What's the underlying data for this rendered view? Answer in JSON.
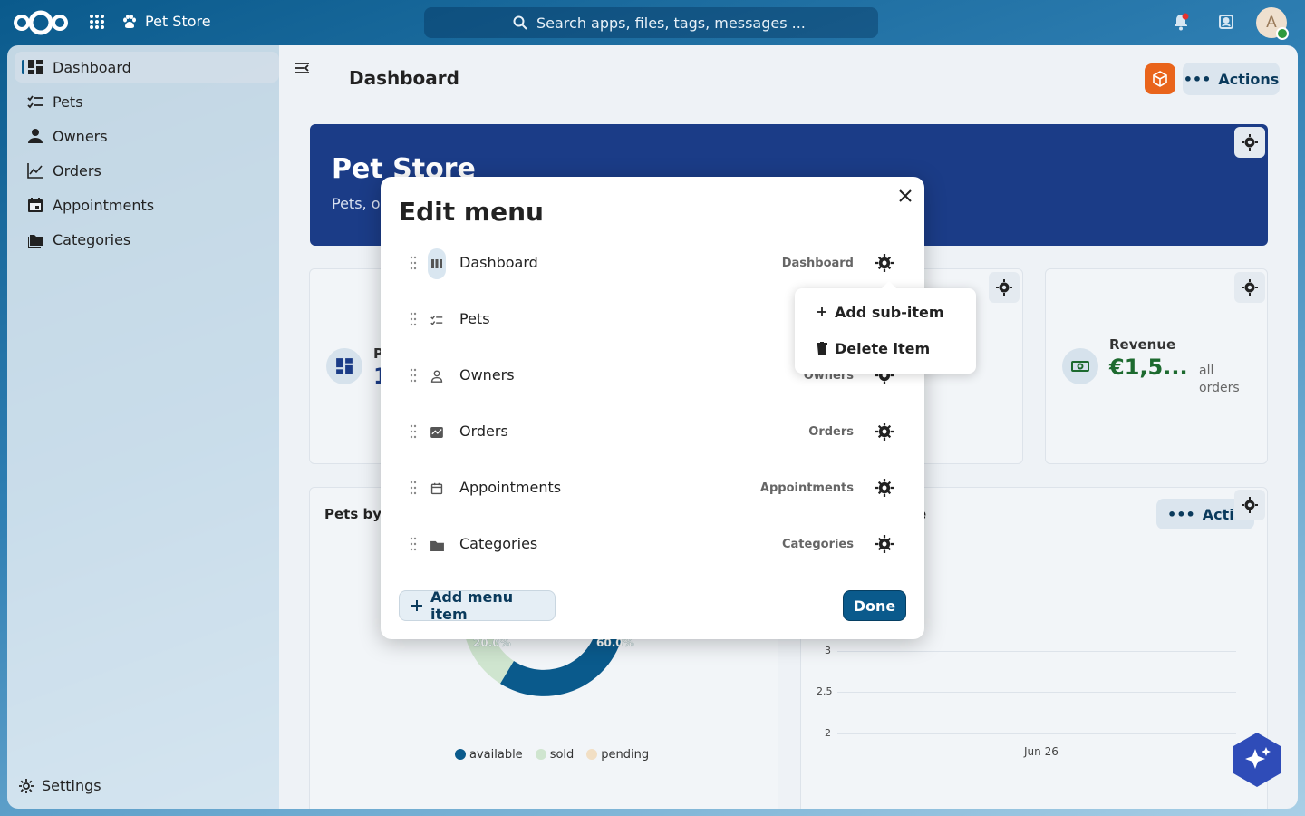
{
  "topbar": {
    "app_name": "Pet Store",
    "search_placeholder": "Search apps, files, tags, messages ...",
    "avatar_initial": "A"
  },
  "sidebar": {
    "items": [
      {
        "label": "Dashboard",
        "icon": "dashboard-icon",
        "active": true
      },
      {
        "label": "Pets",
        "icon": "checklist-icon"
      },
      {
        "label": "Owners",
        "icon": "person-icon"
      },
      {
        "label": "Orders",
        "icon": "chart-line-icon"
      },
      {
        "label": "Appointments",
        "icon": "calendar-icon"
      },
      {
        "label": "Categories",
        "icon": "folders-icon"
      }
    ],
    "settings_label": "Settings"
  },
  "main": {
    "page_title": "Dashboard",
    "actions_label": "Actions",
    "hero": {
      "title": "Pet Store",
      "subtitle": "Pets, o"
    },
    "stat_card_partial": {
      "label": "P",
      "value": "1"
    },
    "revenue": {
      "label": "Revenue",
      "value": "€1,5...",
      "note": "all orders"
    },
    "pets_by_card_title": "Pets by",
    "right_card_title_fragment": "e",
    "actions_label2": "Action",
    "pie": {
      "labels": [
        "20.0%",
        "60.0%"
      ],
      "legend": [
        {
          "name": "available",
          "color": "#0a5a8c"
        },
        {
          "name": "sold",
          "color": "#cfe5cf"
        },
        {
          "name": "pending",
          "color": "#f2dfc4"
        }
      ]
    },
    "line": {
      "yticks": [
        "3",
        "2.5",
        "2"
      ],
      "xticks": [
        "Jun 26"
      ]
    }
  },
  "modal": {
    "title": "Edit menu",
    "rows": [
      {
        "label": "Dashboard",
        "route": "Dashboard",
        "icon": "dashboard-columns-icon"
      },
      {
        "label": "Pets",
        "route": "",
        "icon": "checklist-icon"
      },
      {
        "label": "Owners",
        "route": "Owners",
        "icon": "person-icon"
      },
      {
        "label": "Orders",
        "route": "Orders",
        "icon": "chart-box-icon"
      },
      {
        "label": "Appointments",
        "route": "Appointments",
        "icon": "calendar-icon"
      },
      {
        "label": "Categories",
        "route": "Categories",
        "icon": "folder-icon"
      }
    ],
    "add_item_label": "Add menu item",
    "done_label": "Done"
  },
  "popover": {
    "items": [
      {
        "label": "Add sub-item",
        "icon": "plus-icon"
      },
      {
        "label": "Delete item",
        "icon": "trash-icon"
      }
    ]
  }
}
